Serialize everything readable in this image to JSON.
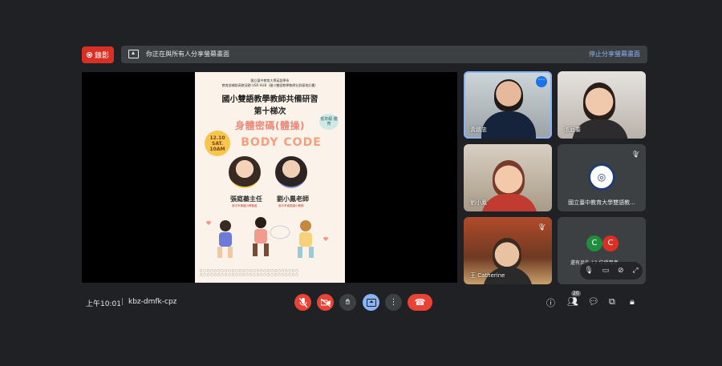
{
  "topbar": {
    "record_label": "錄影",
    "share_message": "你正在與所有人分享螢幕畫面",
    "stop_share_label": "停止分享螢幕畫面"
  },
  "poster": {
    "org_line1": "國立臺中教育大學英語學系",
    "org_line2": "教育部補助高教深耕 USR HUB（國小雙語教學教師社群基地計畫）",
    "title": "國小雙語教學教師共備研習",
    "session": "第十梯次",
    "topic_zh": "身體密碼(體操)",
    "topic_en": "BODY CODE",
    "date_line1": "12.10",
    "date_line2": "SAT.",
    "date_line3": "10AM",
    "tag": "低年級 體育",
    "speaker1": "張庭蓁主任",
    "speaker1_aff": "臺中市美國小教務處",
    "speaker2": "劉小鳳老師",
    "speaker2_aff": "臺中市南區國小教師"
  },
  "participants": [
    {
      "name": "黃鵬忠",
      "icon": "more-options-icon"
    },
    {
      "name": "張庭蓁"
    },
    {
      "name": "劉小鳳"
    },
    {
      "name": "國立臺中教育大學雙語教...",
      "logo": "university-logo-icon"
    },
    {
      "name": "王"
    },
    {
      "name": "Catherine"
    }
  ],
  "others_tile": {
    "avatar1": "C",
    "avatar2": "C",
    "label": "還有另外 12 位使用者"
  },
  "bottom": {
    "time": "上午10:01",
    "separator": "|",
    "meeting_code": "kbz-dmfk-cpz",
    "people_count": "20"
  },
  "colors": {
    "background": "#202124",
    "danger": "#ea4335",
    "accent_blue": "#8ab4f8"
  }
}
